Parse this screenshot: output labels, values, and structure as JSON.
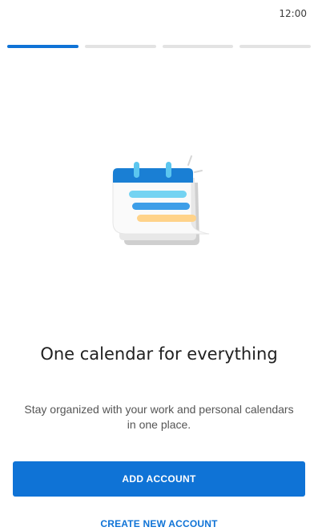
{
  "status_bar": {
    "time": "12:00"
  },
  "progress": {
    "total_steps": 4,
    "current_step": 1
  },
  "illustration": {
    "icon": "calendar-icon"
  },
  "onboarding": {
    "title": "One calendar for everything",
    "subtitle": "Stay organized with your work and personal calendars in one place."
  },
  "actions": {
    "primary_label": "ADD ACCOUNT",
    "secondary_label": "CREATE NEW ACCOUNT"
  },
  "colors": {
    "accent": "#0f73d6",
    "progress_inactive": "#e3e3e3",
    "calendar_header": "#1a7fd4",
    "line_cyan": "#74d3f2",
    "line_blue": "#3d9ee8",
    "line_yellow": "#ffd38a"
  }
}
